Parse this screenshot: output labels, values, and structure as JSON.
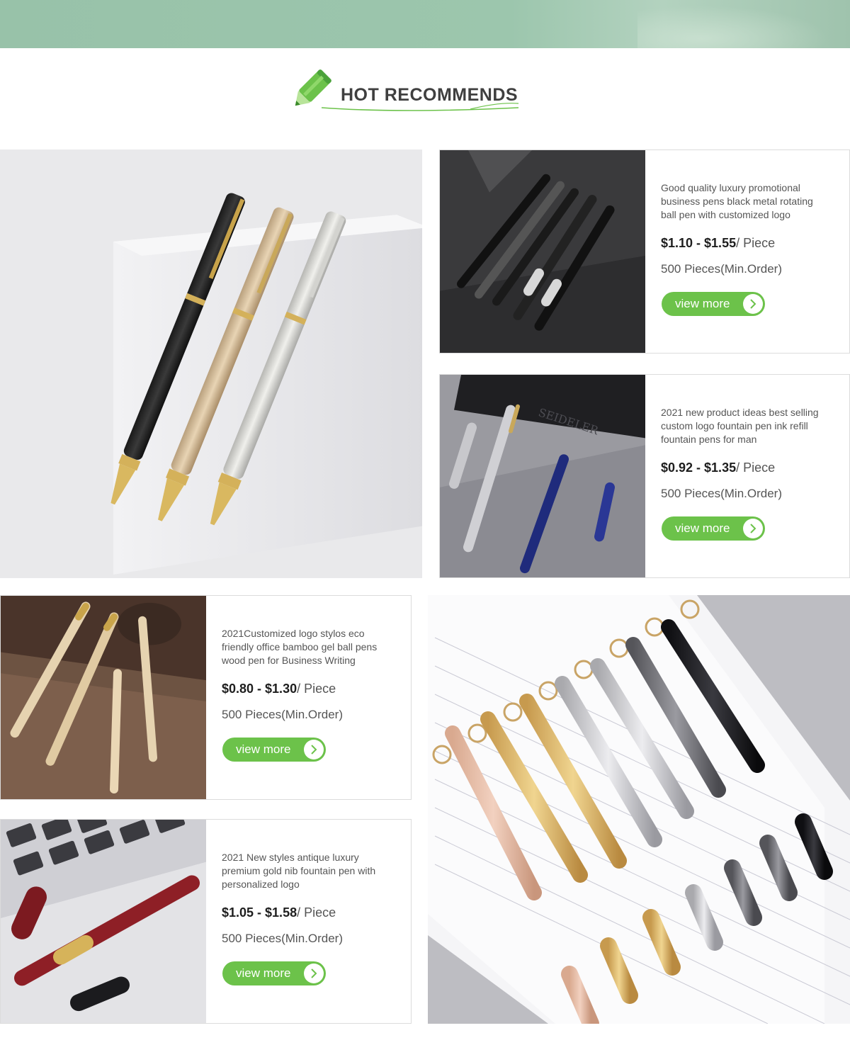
{
  "section": {
    "title": "HOT RECOMMENDS",
    "icon": "pencil-icon"
  },
  "accent_color": "#6cc24a",
  "products": [
    {
      "description": "Good quality luxury promotional business pens black metal rotating ball pen with customized logo",
      "price_range": "$1.10 - $1.55",
      "unit": "/ Piece",
      "moq": "500 Pieces(Min.Order)",
      "button": "view more"
    },
    {
      "description": "2021 new product ideas best selling custom logo fountain pen ink refill fountain pens for man",
      "price_range": "$0.92 - $1.35",
      "unit": "/ Piece",
      "moq": "500 Pieces(Min.Order)",
      "button": "view more",
      "photo_text": "SEIDELER"
    },
    {
      "description": "2021Customized logo stylos eco friendly office bamboo gel ball pens wood pen for Business Writing",
      "price_range": "$0.80 - $1.30",
      "unit": "/ Piece",
      "moq": "500 Pieces(Min.Order)",
      "button": "view more"
    },
    {
      "description": "2021 New styles antique luxury premium gold nib fountain pen with personalized logo",
      "price_range": "$1.05 - $1.58",
      "unit": "/ Piece",
      "moq": "500 Pieces(Min.Order)",
      "button": "view more"
    }
  ]
}
